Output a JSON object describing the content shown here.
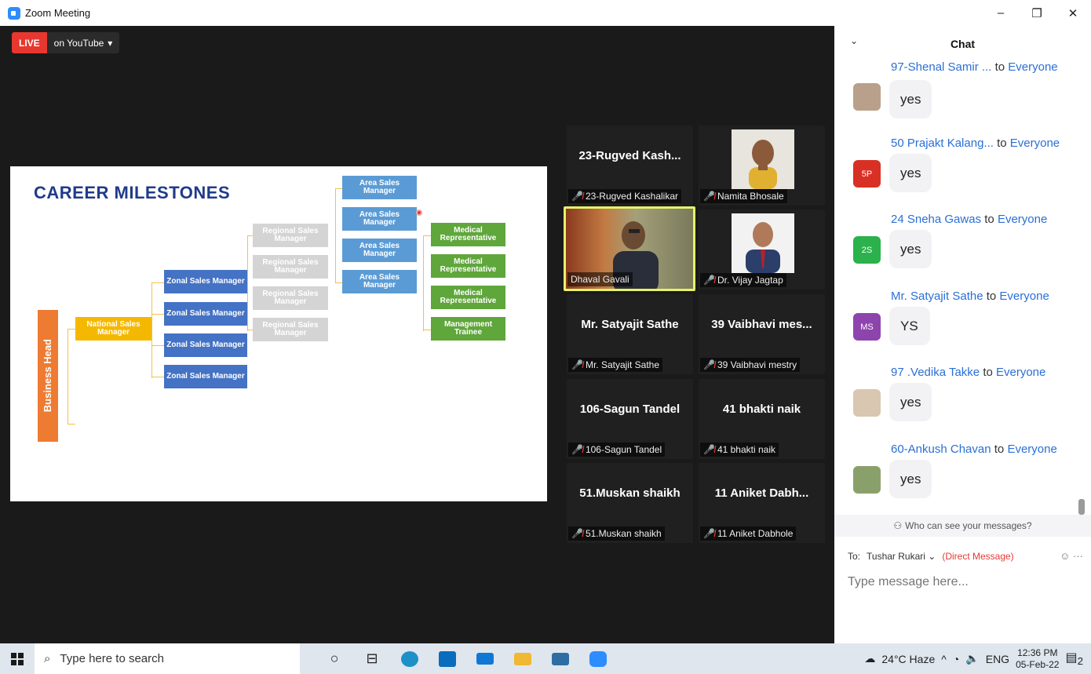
{
  "window": {
    "title": "Zoom Meeting",
    "minimize": "–",
    "restore": "❐",
    "close": "✕"
  },
  "live": {
    "badge": "LIVE",
    "platform": "on YouTube",
    "caret": "▾"
  },
  "slide": {
    "title": "CAREER MILESTONES",
    "business_head": "Business Head",
    "national": "National Sales Manager",
    "zonal": [
      "Zonal Sales Manager",
      "Zonal Sales Manager",
      "Zonal Sales Manager",
      "Zonal Sales Manager"
    ],
    "regional": [
      "Regional Sales Manager",
      "Regional Sales Manager",
      "Regional Sales Manager",
      "Regional Sales Manager"
    ],
    "area": [
      "Area Sales Manager",
      "Area Sales Manager",
      "Area Sales Manager",
      "Area Sales Manager"
    ],
    "medical": [
      "Medical Representative",
      "Medical Representative",
      "Medical Representative",
      "Management Trainee"
    ],
    "colors": {
      "title": "#1f3b8a",
      "business_head": "#ee7b32",
      "national": "#f5b800",
      "zonal": "#4472c4",
      "regional": "#d4d4d4",
      "area": "#5b9bd5",
      "medical": "#5fa63b"
    }
  },
  "gallery": [
    {
      "big": "23-Rugved Kash...",
      "label": "23-Rugved Kashalikar",
      "muted": true,
      "video": false
    },
    {
      "big": "",
      "label": "Namita Bhosale",
      "muted": true,
      "video": true
    },
    {
      "big": "",
      "label": "Dhaval Gavali",
      "muted": false,
      "video": true,
      "active": true
    },
    {
      "big": "",
      "label": "Dr. Vijay Jagtap",
      "muted": true,
      "video": true
    },
    {
      "big": "Mr. Satyajit Sathe",
      "label": "Mr. Satyajit Sathe",
      "muted": true,
      "video": false
    },
    {
      "big": "39 Vaibhavi mes...",
      "label": "39 Vaibhavi mestry",
      "muted": true,
      "video": false
    },
    {
      "big": "106-Sagun Tandel",
      "label": "106-Sagun Tandel",
      "muted": true,
      "video": false
    },
    {
      "big": "41 bhakti naik",
      "label": "41 bhakti naik",
      "muted": true,
      "video": false
    },
    {
      "big": "51.Muskan shaikh",
      "label": "51.Muskan shaikh",
      "muted": true,
      "video": false
    },
    {
      "big": "11 Aniket Dabh...",
      "label": "11 Aniket Dabhole",
      "muted": true,
      "video": false
    }
  ],
  "chat": {
    "title": "Chat",
    "collapse_icon": "⌄",
    "to_word": "to",
    "audience": "Everyone",
    "messages": [
      {
        "sender": "97-Shenal Samir ...",
        "text": "yes",
        "avatar": "",
        "avatar_color": "#b9a08a"
      },
      {
        "sender": "50 Prajakt Kalang...",
        "text": "yes",
        "avatar": "5P",
        "avatar_color": "#d93025"
      },
      {
        "sender": "24 Sneha Gawas",
        "text": "yes",
        "avatar": "2S",
        "avatar_color": "#2bb24c"
      },
      {
        "sender": "Mr. Satyajit Sathe",
        "text": "YS",
        "avatar": "MS",
        "avatar_color": "#8e44ad"
      },
      {
        "sender": "97 .Vedika Takke",
        "text": "yes",
        "avatar": "",
        "avatar_color": "#d9c7b2"
      },
      {
        "sender": "60-Ankush Chavan",
        "text": "yes",
        "avatar": "",
        "avatar_color": "#8aa06a"
      }
    ],
    "who_can_see": "Who can see your messages?",
    "to_label": "To:",
    "recipient": "Tushar Rukari",
    "direct": "(Direct Message)",
    "emoji": "☺",
    "more": "···",
    "placeholder": "Type message here..."
  },
  "taskbar": {
    "search_placeholder": "Type here to search",
    "weather": "24°C  Haze",
    "lang": "ENG",
    "time": "12:36 PM",
    "date": "05-Feb-22",
    "notifications": "2"
  }
}
